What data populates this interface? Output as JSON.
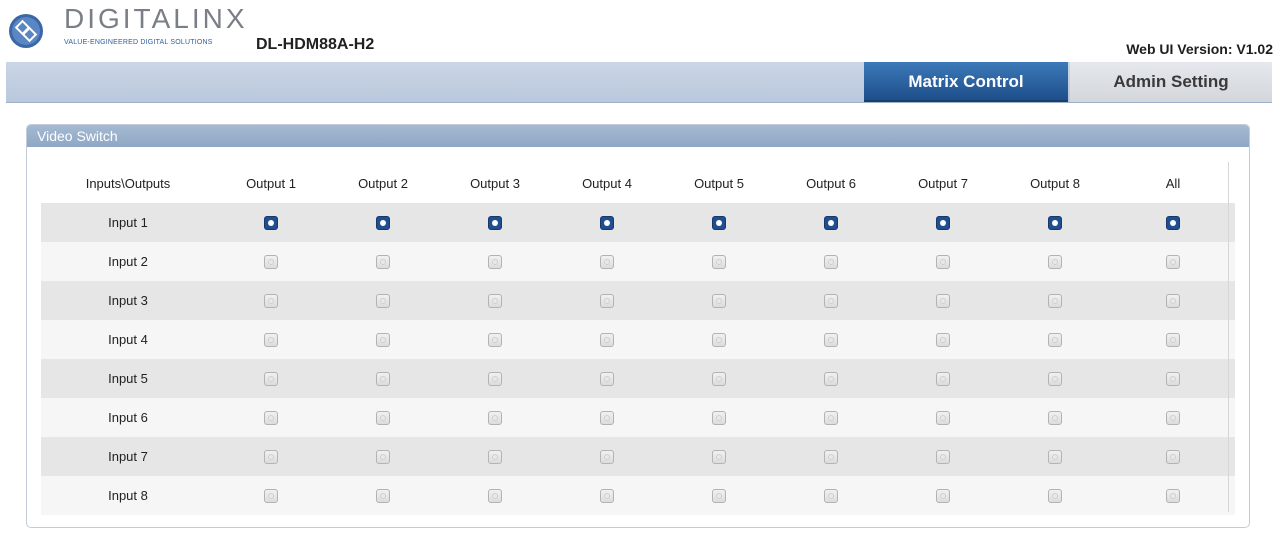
{
  "header": {
    "brand": "DIGITALINX",
    "tagline": "VALUE-ENGINEERED DIGITAL SOLUTIONS",
    "model": "DL-HDM88A-H2",
    "version": "Web UI Version: V1.02",
    "logo_icon": "digitalinx-logo-icon"
  },
  "nav": {
    "tabs": [
      {
        "label": "Matrix Control",
        "active": true
      },
      {
        "label": "Admin Setting",
        "active": false
      }
    ]
  },
  "panel": {
    "title": "Video Switch"
  },
  "matrix": {
    "corner_label": "Inputs\\Outputs",
    "columns": [
      "Output 1",
      "Output 2",
      "Output 3",
      "Output 4",
      "Output 5",
      "Output 6",
      "Output 7",
      "Output 8",
      "All"
    ],
    "rows": [
      {
        "label": "Input 1",
        "selected": [
          true,
          true,
          true,
          true,
          true,
          true,
          true,
          true,
          true
        ]
      },
      {
        "label": "Input 2",
        "selected": [
          false,
          false,
          false,
          false,
          false,
          false,
          false,
          false,
          false
        ]
      },
      {
        "label": "Input 3",
        "selected": [
          false,
          false,
          false,
          false,
          false,
          false,
          false,
          false,
          false
        ]
      },
      {
        "label": "Input 4",
        "selected": [
          false,
          false,
          false,
          false,
          false,
          false,
          false,
          false,
          false
        ]
      },
      {
        "label": "Input 5",
        "selected": [
          false,
          false,
          false,
          false,
          false,
          false,
          false,
          false,
          false
        ]
      },
      {
        "label": "Input 6",
        "selected": [
          false,
          false,
          false,
          false,
          false,
          false,
          false,
          false,
          false
        ]
      },
      {
        "label": "Input 7",
        "selected": [
          false,
          false,
          false,
          false,
          false,
          false,
          false,
          false,
          false
        ]
      },
      {
        "label": "Input 8",
        "selected": [
          false,
          false,
          false,
          false,
          false,
          false,
          false,
          false,
          false
        ]
      }
    ]
  },
  "colors": {
    "accent": "#1f4f8e",
    "nav_bg": "#c3d0e2",
    "panel_header": "#98aec9"
  }
}
